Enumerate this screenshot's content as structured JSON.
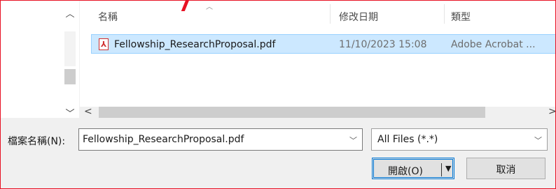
{
  "file_list": {
    "columns": {
      "name": "名稱",
      "date_modified": "修改日期",
      "type": "類型"
    },
    "rows": [
      {
        "name": "Fellowship_ResearchProposal.pdf",
        "date_modified": "11/10/2023 15:08",
        "type": "Adobe Acrobat ...",
        "selected": true
      }
    ]
  },
  "icons": {
    "nav_up": "▲",
    "nav_down": "▼",
    "sort": "▲",
    "scroll_left": "‹",
    "scroll_right": "›",
    "pdf": "pdf-file-icon",
    "dropdown": "▼"
  },
  "filename_field": {
    "label": "檔案名稱(N):",
    "value": "Fellowship_ResearchProposal.pdf"
  },
  "filetype_select": {
    "value": "All Files (*.*)"
  },
  "buttons": {
    "open": "開啟(O)",
    "cancel": "取消"
  },
  "colors": {
    "selection_bg": "#cce8ff",
    "accent": "#0078d7",
    "annotation_red": "#e81123"
  }
}
